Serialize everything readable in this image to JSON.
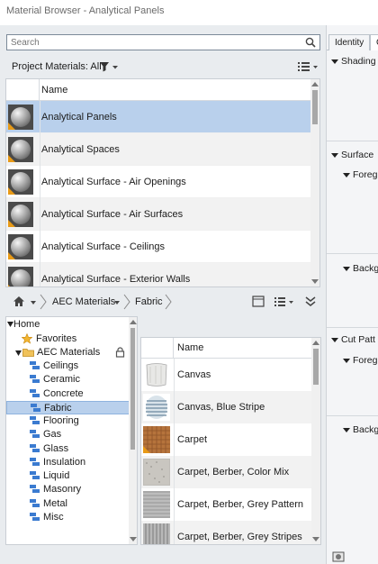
{
  "window": {
    "title": "Material Browser - Analytical Panels"
  },
  "search": {
    "placeholder": "Search"
  },
  "project_materials": {
    "label": "Project Materials: All",
    "column_header": "Name",
    "items": [
      {
        "name": "Analytical Panels",
        "selected": true
      },
      {
        "name": "Analytical Spaces",
        "selected": false
      },
      {
        "name": "Analytical Surface - Air Openings",
        "selected": false
      },
      {
        "name": "Analytical Surface - Air Surfaces",
        "selected": false
      },
      {
        "name": "Analytical Surface - Ceilings",
        "selected": false
      },
      {
        "name": "Analytical Surface - Exterior Walls",
        "selected": false
      }
    ]
  },
  "breadcrumb": {
    "items": [
      "AEC Materials",
      "Fabric"
    ]
  },
  "library_tree": {
    "home": "Home",
    "favorites": "Favorites",
    "library": "AEC Materials",
    "categories": [
      "Ceilings",
      "Ceramic",
      "Concrete",
      "Fabric",
      "Flooring",
      "Gas",
      "Glass",
      "Insulation",
      "Liquid",
      "Masonry",
      "Metal",
      "Misc"
    ],
    "selected": "Fabric"
  },
  "library_grid": {
    "column_header": "Name",
    "items": [
      {
        "name": "Canvas",
        "swatch": "canvas"
      },
      {
        "name": "Canvas, Blue Stripe",
        "swatch": "blue-stripe"
      },
      {
        "name": "Carpet",
        "swatch": "carpet"
      },
      {
        "name": "Carpet, Berber, Color Mix",
        "swatch": "berber-mix"
      },
      {
        "name": "Carpet, Berber, Grey Pattern",
        "swatch": "berber-grey"
      },
      {
        "name": "Carpet, Berber, Grey Stripes",
        "swatch": "berber-stripes"
      }
    ]
  },
  "editor": {
    "tabs": [
      "Identity",
      "G"
    ],
    "sections": [
      {
        "label": "Shading",
        "level": 0
      },
      {
        "label": "Surface",
        "level": 0
      },
      {
        "label": "Foreg",
        "level": 1
      },
      {
        "label": "Backg",
        "level": 1
      },
      {
        "label": "Cut Patt",
        "level": 0
      },
      {
        "label": "Foreg",
        "level": 1
      },
      {
        "label": "Backg",
        "level": 1
      }
    ]
  },
  "colors": {
    "selection": "#b9d0ec",
    "accent": "#3b7bd0",
    "tag": "#e89a16"
  }
}
